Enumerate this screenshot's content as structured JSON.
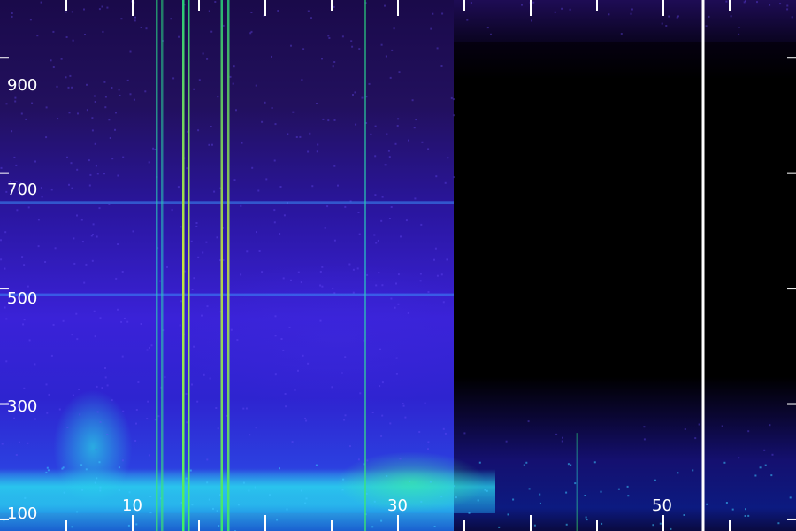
{
  "chart_data": {
    "type": "heatmap",
    "title": "",
    "xlabel": "",
    "ylabel": "",
    "x_ticks": [
      "10",
      "30",
      "50"
    ],
    "y_ticks": [
      "100",
      "300",
      "500",
      "700",
      "900"
    ],
    "x_range": [
      0,
      60
    ],
    "y_range": [
      80,
      1000
    ],
    "colors": {
      "background": "#000000",
      "low": "#2a16a0",
      "mid": "#3a22d8",
      "high": "#30d0e8",
      "peak": "#60ff60",
      "axis": "#ffffff"
    },
    "vertical_lines": [
      {
        "x": 11.8,
        "intensity": 0.6
      },
      {
        "x": 12.2,
        "intensity": 0.5
      },
      {
        "x": 13.8,
        "intensity": 0.95
      },
      {
        "x": 14.2,
        "intensity": 0.85
      },
      {
        "x": 16.7,
        "intensity": 0.8
      },
      {
        "x": 17.2,
        "intensity": 0.75
      },
      {
        "x": 27.5,
        "intensity": 0.55
      },
      {
        "x": 43.5,
        "intensity": 0.35
      }
    ],
    "horizontal_lines": [
      {
        "y": 650,
        "intensity": 0.5
      },
      {
        "y": 490,
        "intensity": 0.5
      }
    ],
    "cursor_line_x": 53
  }
}
